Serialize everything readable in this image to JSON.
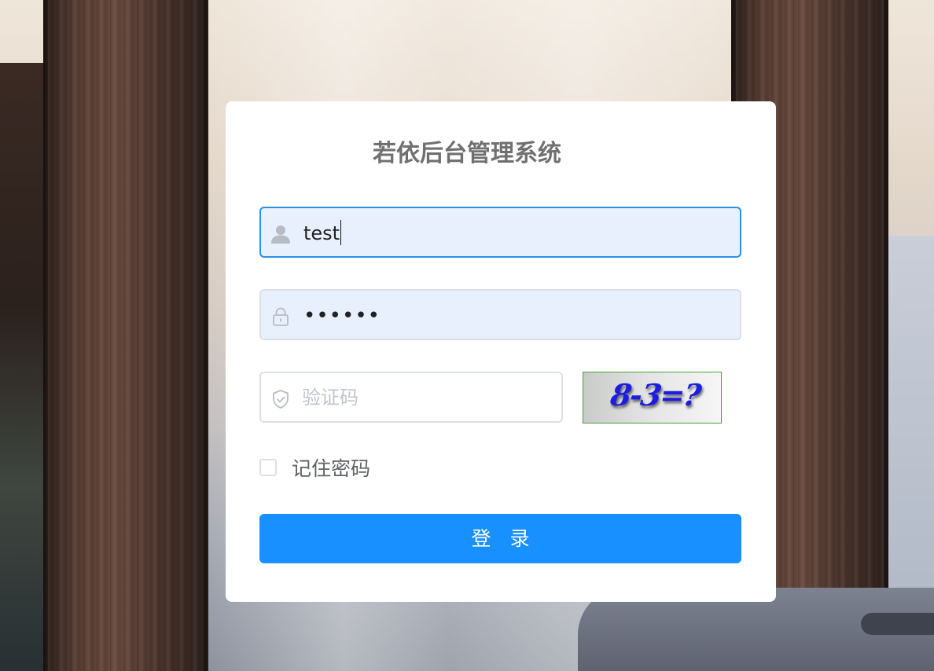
{
  "app": {
    "title": "若依后台管理系统"
  },
  "login_form": {
    "username": {
      "value": "test",
      "icon": "user-icon"
    },
    "password": {
      "masked_value": "••••••",
      "icon": "lock-icon"
    },
    "captcha_input": {
      "placeholder": "验证码",
      "value": "",
      "icon": "shield-check-icon"
    },
    "captcha_image": {
      "text": "8-3=?"
    },
    "remember_me": {
      "label": "记住密码",
      "checked": false
    },
    "submit_label": "登 录"
  },
  "colors": {
    "primary": "#1890ff",
    "input_focus_border": "#2f8fe6",
    "autofill_bg": "#e8f0fe",
    "title": "#707070"
  }
}
